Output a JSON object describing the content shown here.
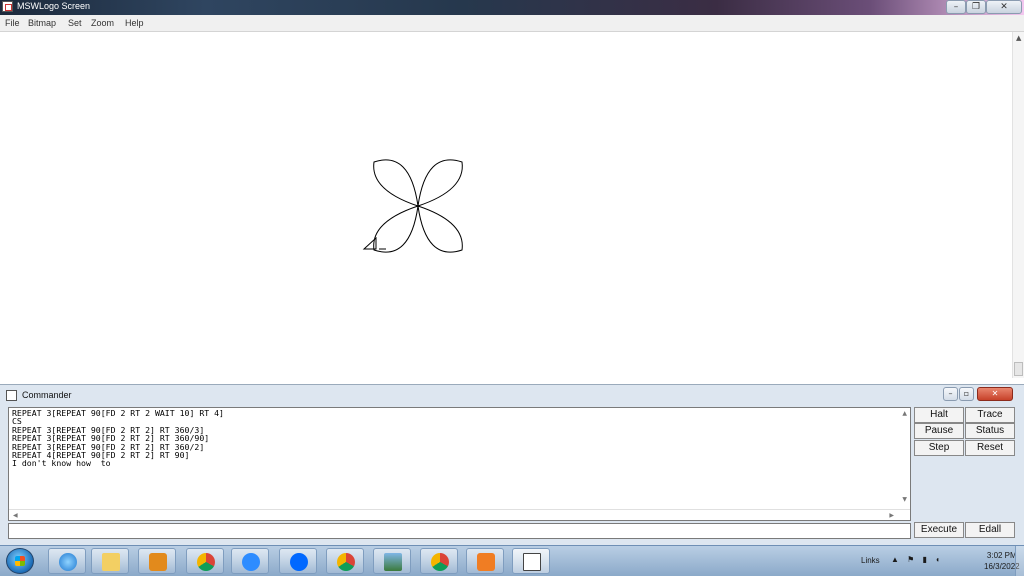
{
  "window": {
    "title": "MSWLogo Screen",
    "controls": [
      "–",
      "❐",
      "✕"
    ]
  },
  "menu": [
    "File",
    "Bitmap",
    "Set",
    "Zoom",
    "Help"
  ],
  "commander": {
    "title": "Commander",
    "history": [
      "REPEAT 3[REPEAT 90[FD 2 RT 2 WAIT 10] RT 4]",
      "CS",
      "REPEAT 3[REPEAT 90[FD 2 RT 2] RT 360/3]",
      "REPEAT 3[REPEAT 90[FD 2 RT 2] RT 360/90]",
      "REPEAT 3[REPEAT 90[FD 2 RT 2] RT 360/2]",
      "REPEAT 4[REPEAT 90[FD 2 RT 2] RT 90]",
      "I don't know how  to"
    ],
    "input_value": "",
    "buttons": {
      "halt": "Halt",
      "trace": "Trace",
      "pause": "Pause",
      "status": "Status",
      "step": "Step",
      "reset": "Reset",
      "execute": "Execute",
      "edall": "Edall"
    }
  },
  "taskbar": {
    "apps": [
      "internet-explorer",
      "file-explorer",
      "media-player",
      "chrome",
      "zoom",
      "zalo",
      "chrome-profile",
      "photos",
      "chrome-profile-2",
      "pdf-reader",
      "mswlogo"
    ],
    "tray": {
      "links_label": "Links",
      "time": "3:02 PM",
      "date": "16/3/2022"
    }
  }
}
